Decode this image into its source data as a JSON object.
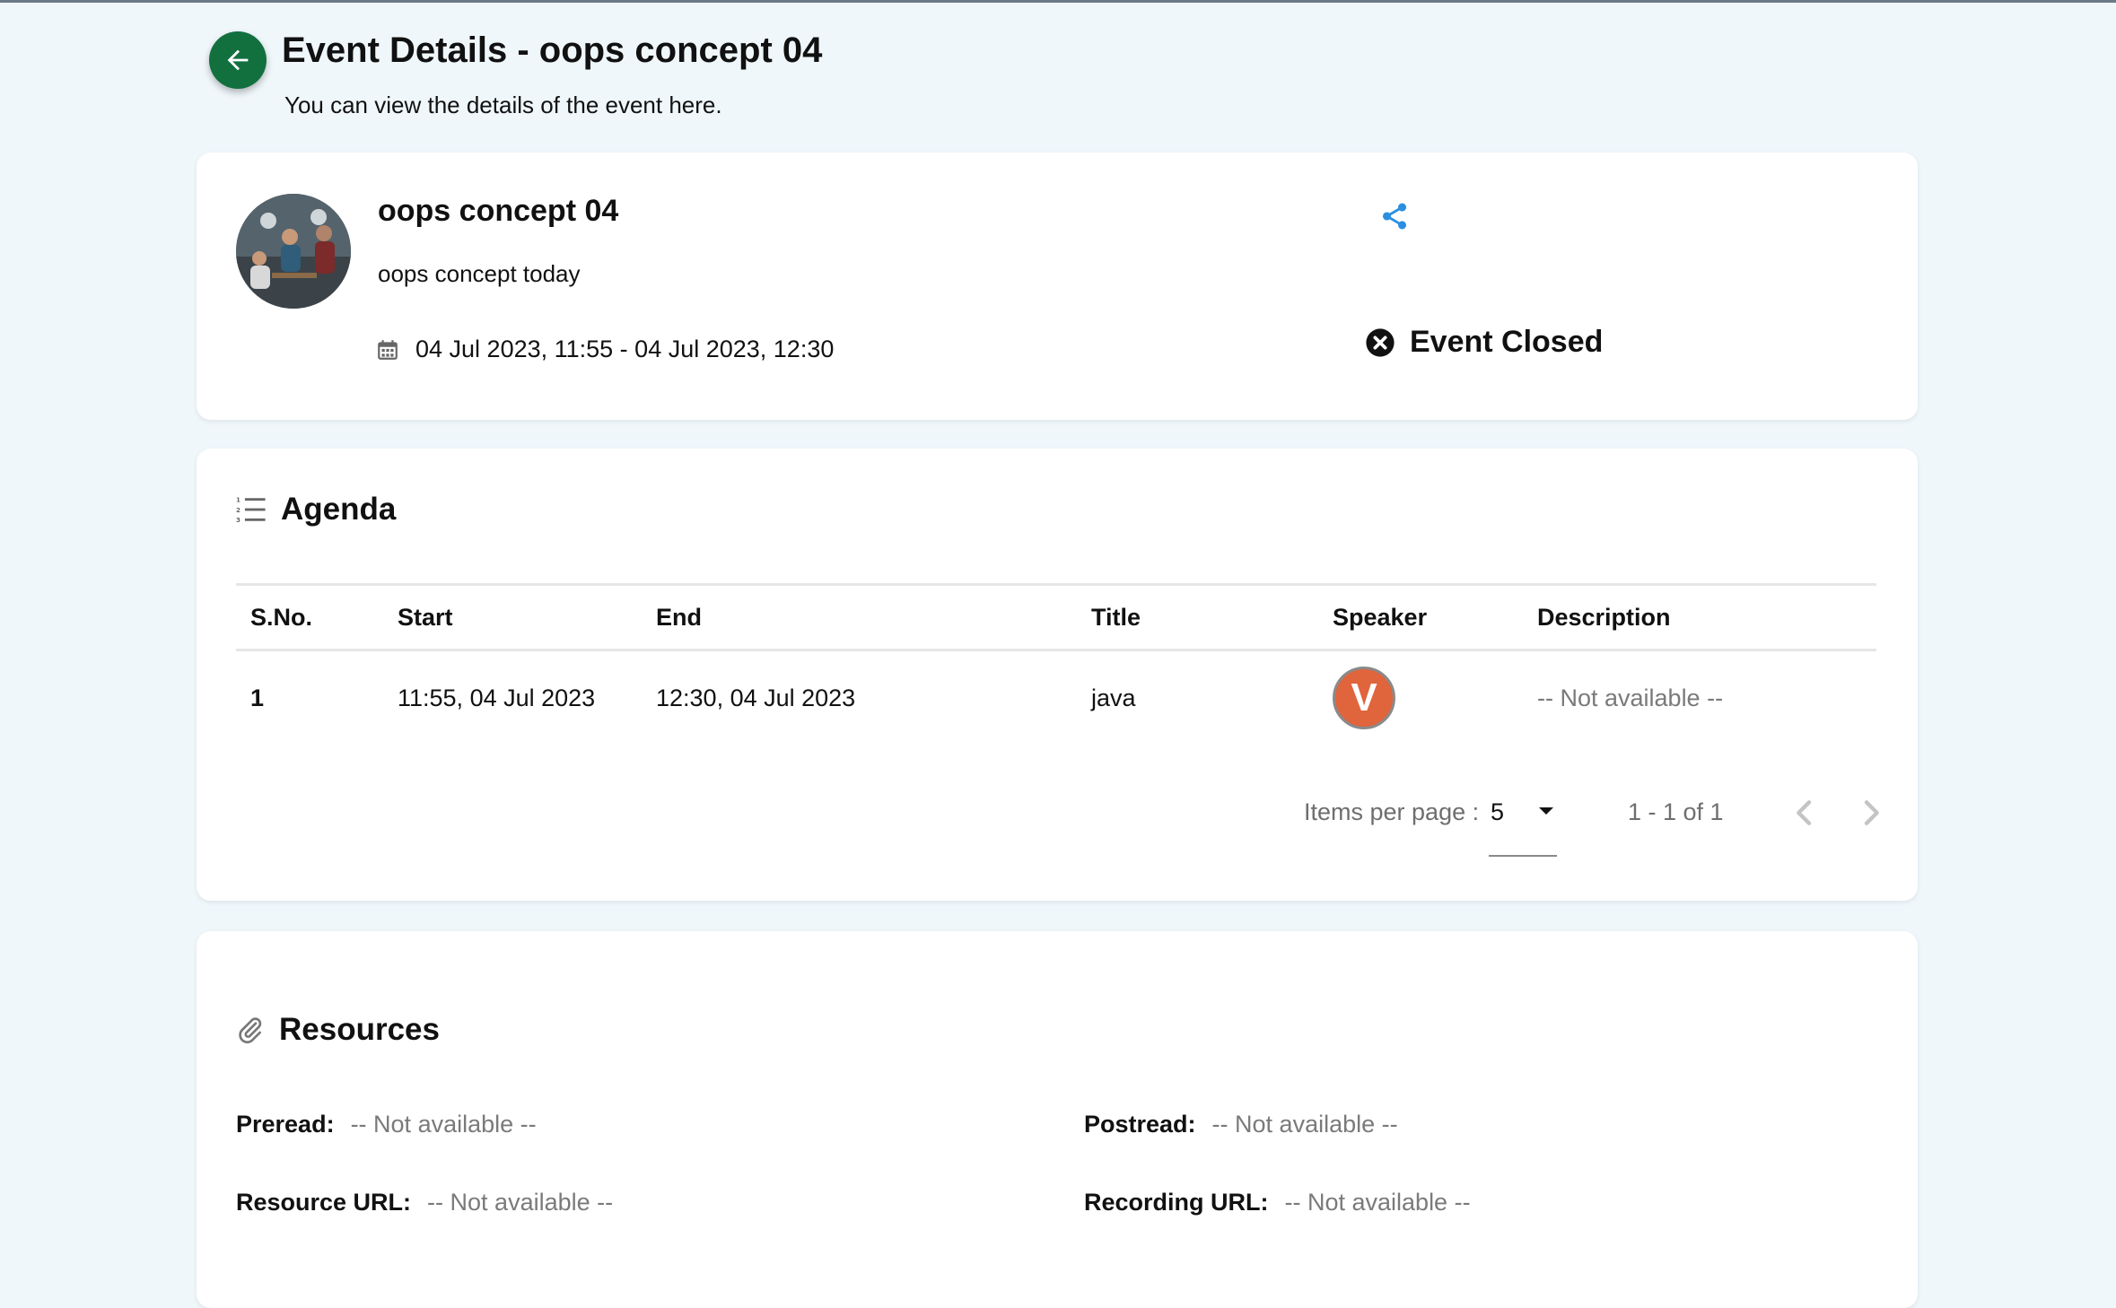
{
  "header": {
    "title": "Event Details - oops concept 04",
    "subtitle": "You can view the details of the event here."
  },
  "event": {
    "name": "oops concept 04",
    "description": "oops concept today",
    "datetime": "04 Jul 2023, 11:55 - 04 Jul 2023, 12:30",
    "status": "Event Closed"
  },
  "agenda": {
    "title": "Agenda",
    "columns": [
      "S.No.",
      "Start",
      "End",
      "Title",
      "Speaker",
      "Description"
    ],
    "rows": [
      {
        "sno": "1",
        "start": "11:55, 04 Jul 2023",
        "end": "12:30, 04 Jul 2023",
        "title": "java",
        "speaker_initial": "V",
        "description": "-- Not available --"
      }
    ],
    "pager": {
      "items_label": "Items per page :",
      "items_value": "5",
      "range": "1 - 1 of 1"
    }
  },
  "resources": {
    "title": "Resources",
    "preread_label": "Preread:",
    "preread_value": "-- Not available --",
    "postread_label": "Postread:",
    "postread_value": "-- Not available --",
    "resource_url_label": "Resource URL:",
    "resource_url_value": "-- Not available --",
    "recording_url_label": "Recording URL:",
    "recording_url_value": "-- Not available --"
  },
  "colors": {
    "back_button": "#12703f",
    "speaker_badge": "#e0643c",
    "share_icon": "#2b8fe0"
  }
}
